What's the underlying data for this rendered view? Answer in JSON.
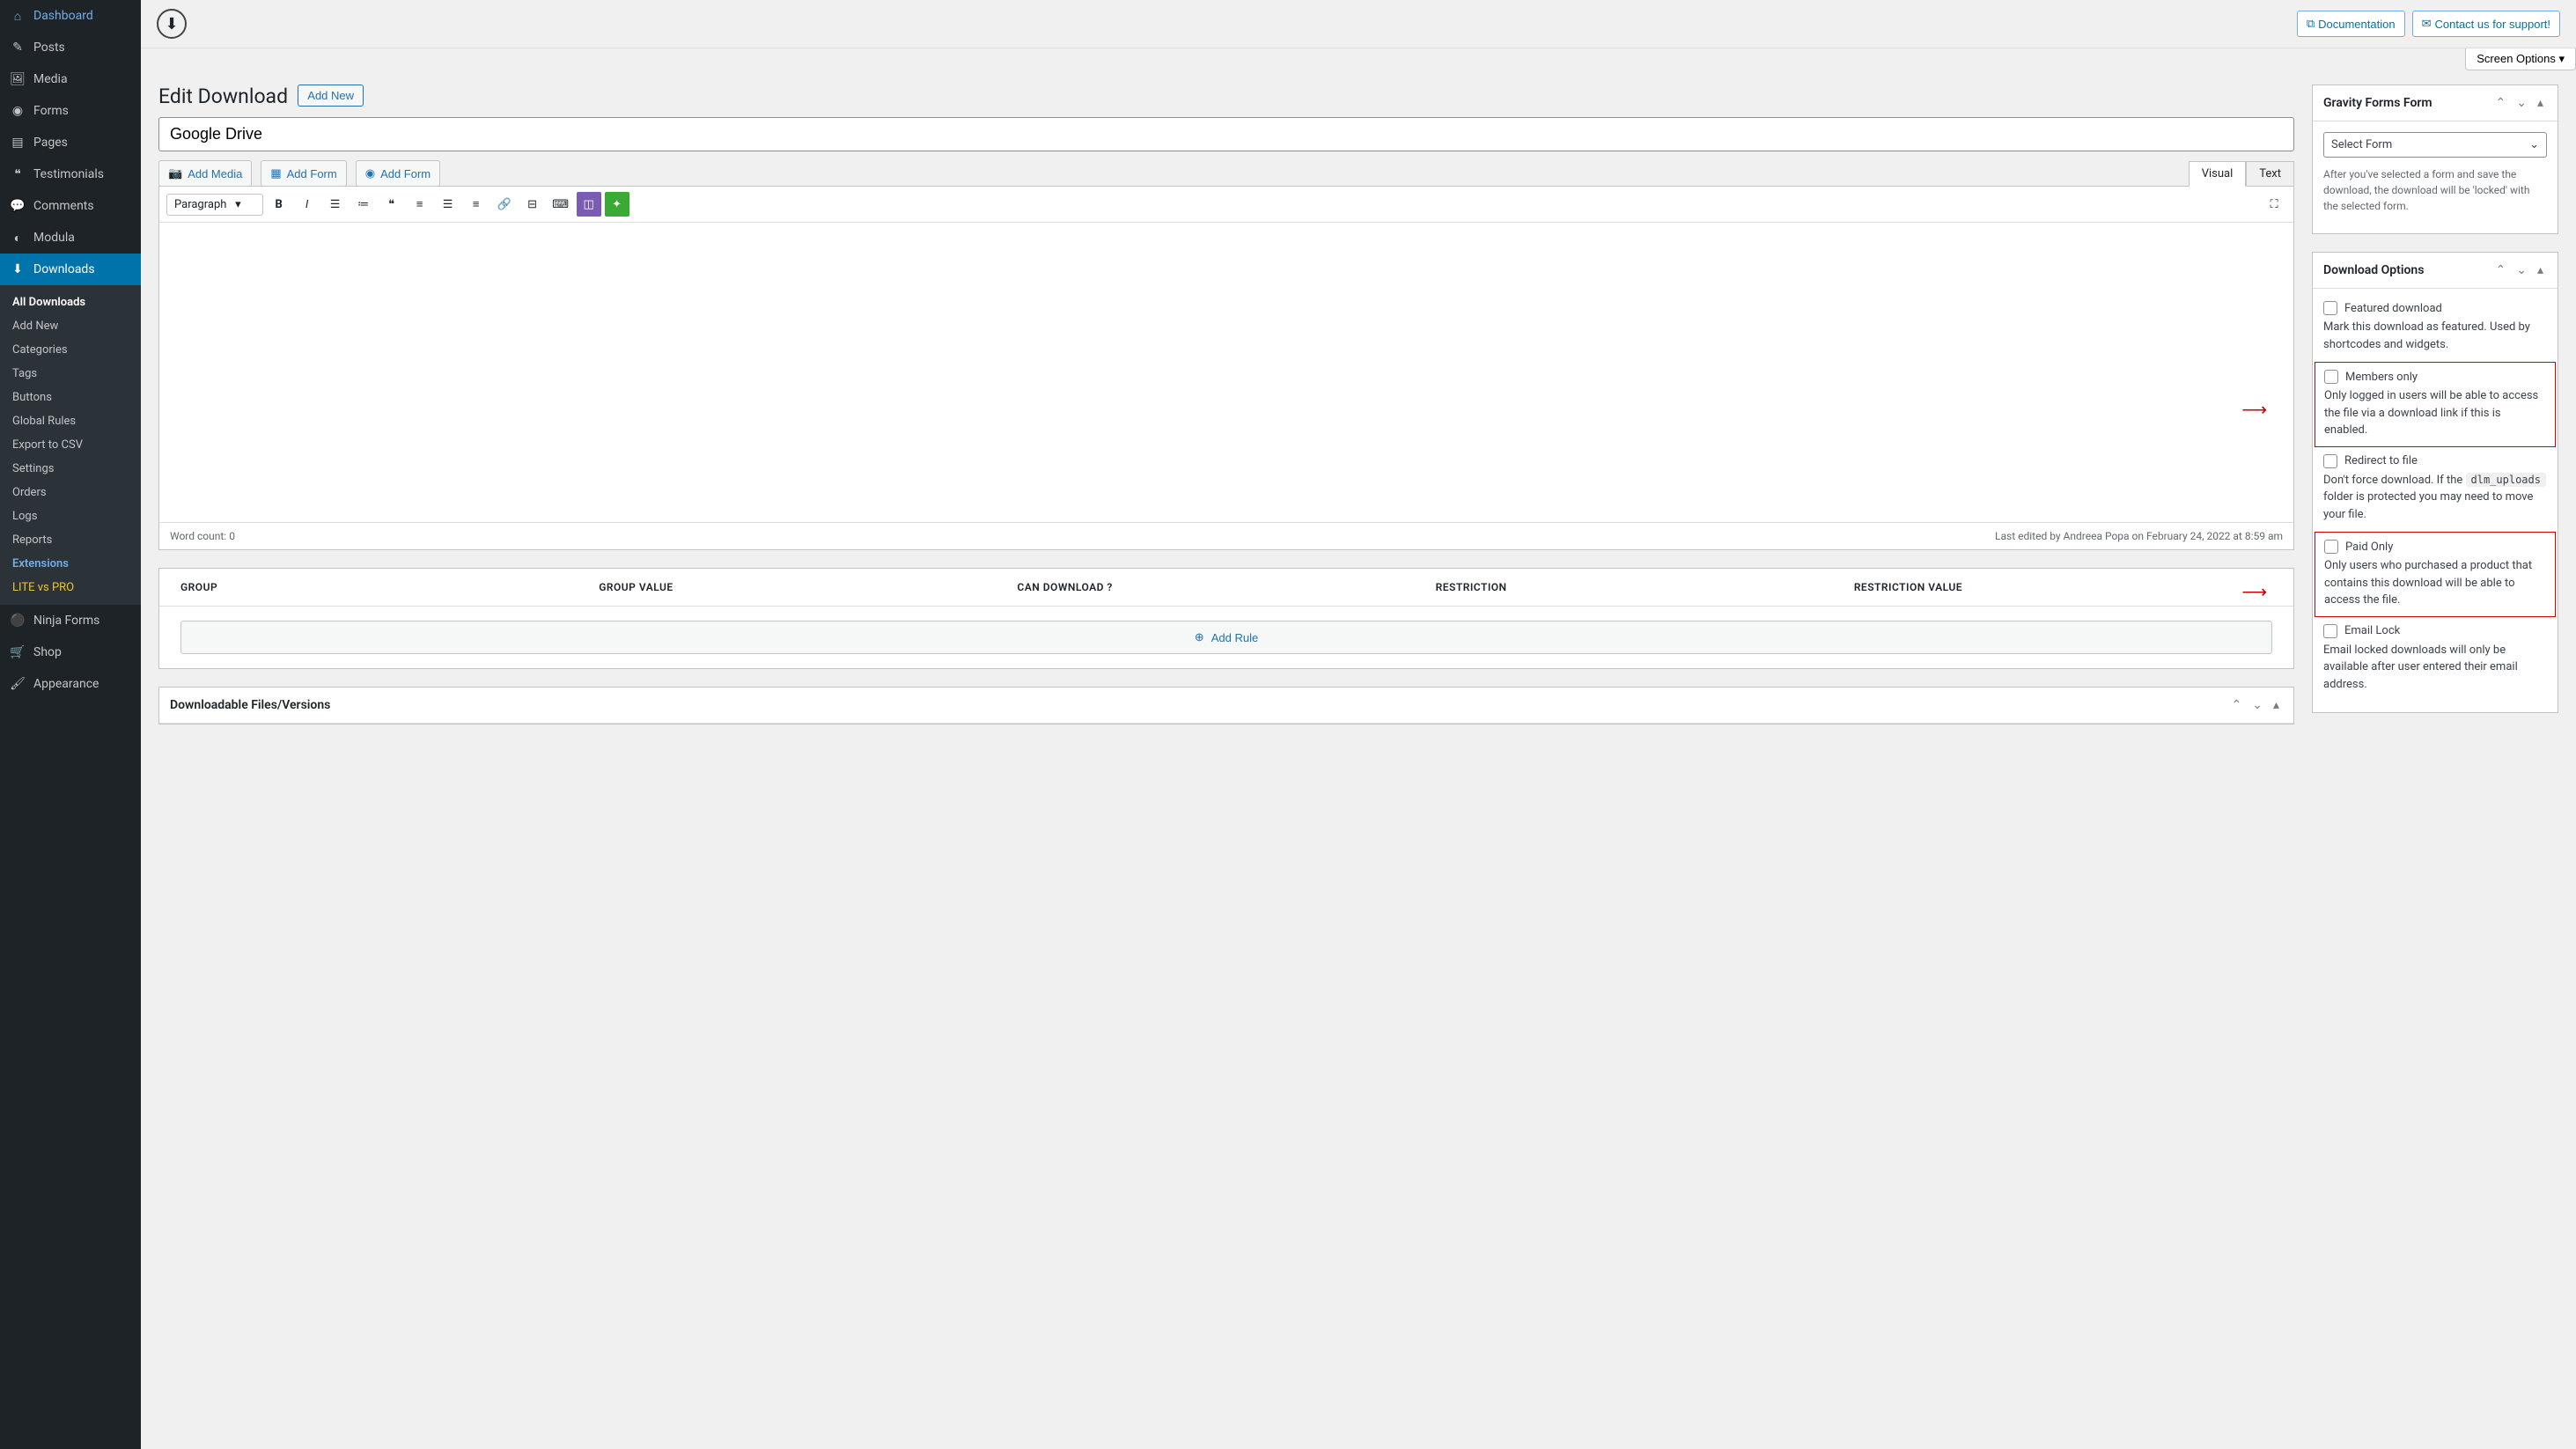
{
  "sidebar": {
    "items": [
      {
        "label": "Dashboard"
      },
      {
        "label": "Posts"
      },
      {
        "label": "Media"
      },
      {
        "label": "Forms"
      },
      {
        "label": "Pages"
      },
      {
        "label": "Testimonials"
      },
      {
        "label": "Comments"
      },
      {
        "label": "Modula"
      },
      {
        "label": "Downloads"
      },
      {
        "label": "Ninja Forms"
      },
      {
        "label": "Shop"
      },
      {
        "label": "Appearance"
      }
    ],
    "submenu": {
      "items": [
        "All Downloads",
        "Add New",
        "Categories",
        "Tags",
        "Buttons",
        "Global Rules",
        "Export to CSV",
        "Settings",
        "Orders",
        "Logs",
        "Reports",
        "Extensions",
        "LITE vs PRO"
      ]
    }
  },
  "topbar": {
    "doc": "Documentation",
    "contact": "Contact us for support!",
    "screen_options": "Screen Options"
  },
  "page": {
    "title": "Edit Download",
    "add_new": "Add New",
    "post_title": "Google Drive"
  },
  "media_buttons": {
    "add_media": "Add Media",
    "add_form1": "Add Form",
    "add_form2": "Add Form"
  },
  "editor": {
    "tabs": {
      "visual": "Visual",
      "text": "Text"
    },
    "paragraph": "Paragraph",
    "word_count_label": "Word count: ",
    "word_count": "0",
    "last_edited": "Last edited by Andreea Popa on February 24, 2022 at 8:59 am"
  },
  "rules": {
    "headers": [
      "GROUP",
      "GROUP VALUE",
      "CAN DOWNLOAD ?",
      "RESTRICTION",
      "RESTRICTION VALUE"
    ],
    "add_rule": "Add Rule"
  },
  "files_panel": {
    "title": "Downloadable Files/Versions"
  },
  "gravity": {
    "title": "Gravity Forms Form",
    "select_label": "Select Form",
    "help": "After you've selected a form and save the download, the download will be 'locked' with the selected form."
  },
  "download_options": {
    "title": "Download Options",
    "featured": {
      "label": "Featured download",
      "help": "Mark this download as featured. Used by shortcodes and widgets."
    },
    "members": {
      "label": "Members only",
      "help": "Only logged in users will be able to access the file via a download link if this is enabled."
    },
    "redirect": {
      "label": "Redirect to file",
      "help_pre": "Don't force download. If the ",
      "code": "dlm_uploads",
      "help_post": " folder is protected you may need to move your file."
    },
    "paid": {
      "label": "Paid Only",
      "help": "Only users who purchased a product that contains this download will be able to access the file."
    },
    "email": {
      "label": "Email Lock",
      "help": "Email locked downloads will only be available after user entered their email address."
    }
  }
}
